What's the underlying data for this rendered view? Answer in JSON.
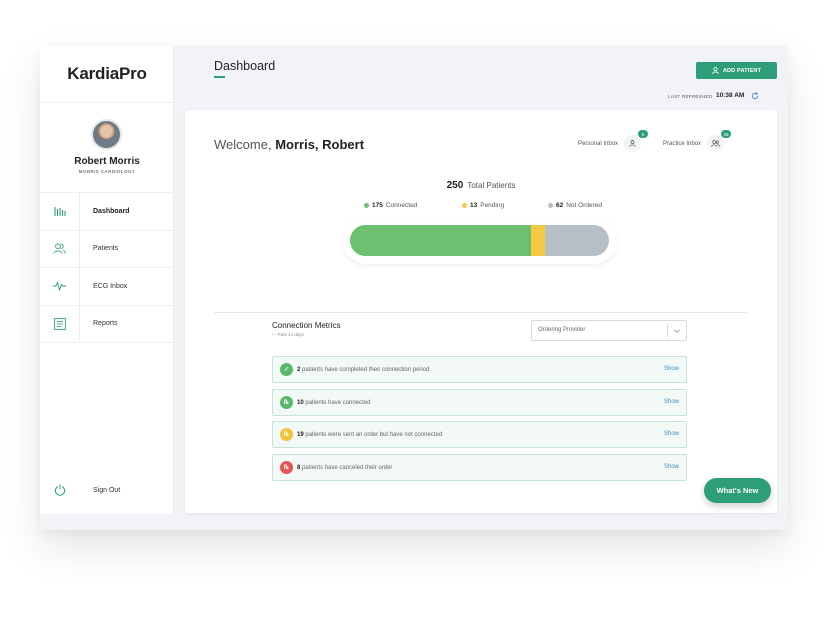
{
  "app": {
    "logo": "KardiaPro"
  },
  "user": {
    "name": "Robert Morris",
    "org": "MORRIS CARDIOLOGY"
  },
  "nav": {
    "items": [
      {
        "label": "Dashboard",
        "icon": "bar-chart-icon"
      },
      {
        "label": "Patients",
        "icon": "people-icon"
      },
      {
        "label": "ECG Inbox",
        "icon": "pulse-icon"
      },
      {
        "label": "Reports",
        "icon": "report-icon"
      }
    ],
    "signout": {
      "label": "Sign Out",
      "icon": "power-icon"
    }
  },
  "header": {
    "title": "Dashboard",
    "add_patient": "ADD PATIENT",
    "last_refreshed_label": "LAST REFRESHED",
    "last_refreshed_time": "10:38 AM"
  },
  "welcome": {
    "prefix": "Welcome,",
    "name": "Morris, Robert"
  },
  "inbox": {
    "personal": {
      "label": "Personal Inbox",
      "count": "6"
    },
    "practice": {
      "label": "Practice Inbox",
      "count": "45"
    }
  },
  "summary": {
    "total": "250",
    "total_label": "Total Patients",
    "legend": [
      {
        "value": "175",
        "label": "Connected",
        "color": "#6cc070"
      },
      {
        "value": "13",
        "label": "Pending",
        "color": "#f7c844"
      },
      {
        "value": "62",
        "label": "Not Ordered",
        "color": "#b6bfc6"
      }
    ]
  },
  "chart_data": {
    "type": "bar",
    "categories": [
      "Connected",
      "Pending",
      "Not Ordered"
    ],
    "values": [
      175,
      13,
      62
    ],
    "colors": [
      "#6cc070",
      "#f7c844",
      "#b6bfc6"
    ]
  },
  "metrics": {
    "title": "Connection Metrics",
    "subtitle": "— Past 14 days",
    "dropdown": "Ordering Provider",
    "rows": [
      {
        "count": "2",
        "text": "patients have completed their connection period",
        "action": "Show",
        "icon": "check-circle-icon",
        "color": "#59b86a",
        "glyph": "✓"
      },
      {
        "count": "10",
        "text": "patients have connected",
        "action": "Show",
        "icon": "rx-green-icon",
        "color": "#59b86a",
        "glyph": "℞"
      },
      {
        "count": "19",
        "text": "patients were sent an order but have not connected",
        "action": "Show",
        "icon": "rx-yellow-icon",
        "color": "#f5c33b",
        "glyph": "℞"
      },
      {
        "count": "8",
        "text": "patients have canceled their order",
        "action": "Show",
        "icon": "rx-red-icon",
        "color": "#e55454",
        "glyph": "℞"
      }
    ]
  },
  "whats_new": "What's New",
  "colors": {
    "brand": "#2e9e7a",
    "link": "#3e8ec2"
  }
}
